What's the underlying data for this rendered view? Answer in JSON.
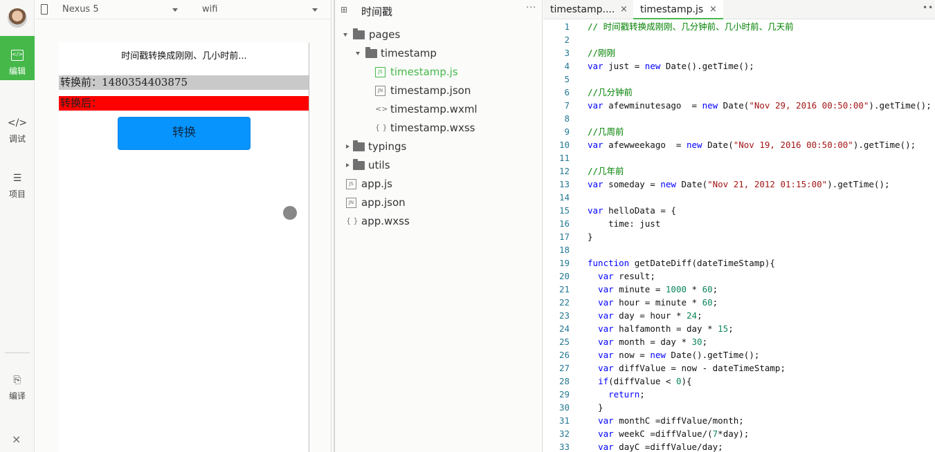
{
  "sidebar": {
    "items": [
      {
        "label": "编辑",
        "icon": "code-icon"
      },
      {
        "label": "调试",
        "icon": "debug-icon"
      },
      {
        "label": "项目",
        "icon": "menu-icon"
      },
      {
        "label": "编译",
        "icon": "compile-icon"
      }
    ],
    "close_icon": "×"
  },
  "simulator": {
    "device": "Nexus 5",
    "network": "wifi",
    "page_title": "时间戳转换成刚刚、几小时前...",
    "before_label": "转换前：1480354403875",
    "after_label": "转换后：",
    "button_label": "转换"
  },
  "file_tree": {
    "title": "时间戳",
    "more": "···",
    "nodes": [
      {
        "label": "pages",
        "kind": "folder",
        "open": true
      },
      {
        "label": "timestamp",
        "kind": "folder",
        "open": true
      },
      {
        "label": "timestamp.js",
        "kind": "js",
        "badge": "JS",
        "selected": true
      },
      {
        "label": "timestamp.json",
        "kind": "json",
        "badge": "JN"
      },
      {
        "label": "timestamp.wxml",
        "kind": "wxml",
        "badge": "<>"
      },
      {
        "label": "timestamp.wxss",
        "kind": "wxss",
        "badge": "{ }"
      },
      {
        "label": "typings",
        "kind": "folder",
        "open": false
      },
      {
        "label": "utils",
        "kind": "folder",
        "open": false
      },
      {
        "label": "app.js",
        "kind": "js",
        "badge": "JS"
      },
      {
        "label": "app.json",
        "kind": "json",
        "badge": "JN"
      },
      {
        "label": "app.wxss",
        "kind": "wxss",
        "badge": "{ }"
      }
    ]
  },
  "editor": {
    "tabs": [
      {
        "label": "timestamp....",
        "close": "×",
        "active": false
      },
      {
        "label": "timestamp.js",
        "close": "×",
        "active": true
      }
    ],
    "more": "••",
    "lines": [
      [
        [
          "c",
          "// 时间戳转换成刚刚、几分钟前、几小时前、几天前"
        ]
      ],
      [],
      [
        [
          "c",
          "//刚刚"
        ]
      ],
      [
        [
          "k",
          "var"
        ],
        [
          "t",
          " just = "
        ],
        [
          "k",
          "new"
        ],
        [
          "t",
          " Date().getTime();"
        ]
      ],
      [],
      [
        [
          "c",
          "//几分钟前"
        ]
      ],
      [
        [
          "k",
          "var"
        ],
        [
          "t",
          " afewminutesago  = "
        ],
        [
          "k",
          "new"
        ],
        [
          "t",
          " Date("
        ],
        [
          "s",
          "\"Nov 29, 2016 00:50:00\""
        ],
        [
          "t",
          ").getTime();"
        ]
      ],
      [],
      [
        [
          "c",
          "//几周前"
        ]
      ],
      [
        [
          "k",
          "var"
        ],
        [
          "t",
          " afewweekago  = "
        ],
        [
          "k",
          "new"
        ],
        [
          "t",
          " Date("
        ],
        [
          "s",
          "\"Nov 19, 2016 00:50:00\""
        ],
        [
          "t",
          ").getTime();"
        ]
      ],
      [],
      [
        [
          "c",
          "//几年前"
        ]
      ],
      [
        [
          "k",
          "var"
        ],
        [
          "t",
          " someday = "
        ],
        [
          "k",
          "new"
        ],
        [
          "t",
          " Date("
        ],
        [
          "s",
          "\"Nov 21, 2012 01:15:00\""
        ],
        [
          "t",
          ").getTime();"
        ]
      ],
      [],
      [
        [
          "k",
          "var"
        ],
        [
          "t",
          " helloData = {"
        ]
      ],
      [
        [
          "t",
          "    time: just"
        ]
      ],
      [
        [
          "t",
          "}"
        ]
      ],
      [],
      [
        [
          "k",
          "function"
        ],
        [
          "t",
          " getDateDiff(dateTimeStamp){"
        ]
      ],
      [
        [
          "t",
          "  "
        ],
        [
          "k",
          "var"
        ],
        [
          "t",
          " result;"
        ]
      ],
      [
        [
          "t",
          "  "
        ],
        [
          "k",
          "var"
        ],
        [
          "t",
          " minute = "
        ],
        [
          "n",
          "1000"
        ],
        [
          "t",
          " * "
        ],
        [
          "n",
          "60"
        ],
        [
          "t",
          ";"
        ]
      ],
      [
        [
          "t",
          "  "
        ],
        [
          "k",
          "var"
        ],
        [
          "t",
          " hour = minute * "
        ],
        [
          "n",
          "60"
        ],
        [
          "t",
          ";"
        ]
      ],
      [
        [
          "t",
          "  "
        ],
        [
          "k",
          "var"
        ],
        [
          "t",
          " day = hour * "
        ],
        [
          "n",
          "24"
        ],
        [
          "t",
          ";"
        ]
      ],
      [
        [
          "t",
          "  "
        ],
        [
          "k",
          "var"
        ],
        [
          "t",
          " halfamonth = day * "
        ],
        [
          "n",
          "15"
        ],
        [
          "t",
          ";"
        ]
      ],
      [
        [
          "t",
          "  "
        ],
        [
          "k",
          "var"
        ],
        [
          "t",
          " month = day * "
        ],
        [
          "n",
          "30"
        ],
        [
          "t",
          ";"
        ]
      ],
      [
        [
          "t",
          "  "
        ],
        [
          "k",
          "var"
        ],
        [
          "t",
          " now = "
        ],
        [
          "k",
          "new"
        ],
        [
          "t",
          " Date().getTime();"
        ]
      ],
      [
        [
          "t",
          "  "
        ],
        [
          "k",
          "var"
        ],
        [
          "t",
          " diffValue = now - dateTimeStamp;"
        ]
      ],
      [
        [
          "t",
          "  "
        ],
        [
          "k",
          "if"
        ],
        [
          "t",
          "(diffValue < "
        ],
        [
          "n",
          "0"
        ],
        [
          "t",
          "){"
        ]
      ],
      [
        [
          "t",
          "    "
        ],
        [
          "k",
          "return"
        ],
        [
          "t",
          ";"
        ]
      ],
      [
        [
          "t",
          "  }"
        ]
      ],
      [
        [
          "t",
          "  "
        ],
        [
          "k",
          "var"
        ],
        [
          "t",
          " monthC =diffValue/month;"
        ]
      ],
      [
        [
          "t",
          "  "
        ],
        [
          "k",
          "var"
        ],
        [
          "t",
          " weekC =diffValue/("
        ],
        [
          "n",
          "7"
        ],
        [
          "t",
          "*day);"
        ]
      ],
      [
        [
          "t",
          "  "
        ],
        [
          "k",
          "var"
        ],
        [
          "t",
          " dayC =diffValue/day;"
        ]
      ]
    ]
  }
}
